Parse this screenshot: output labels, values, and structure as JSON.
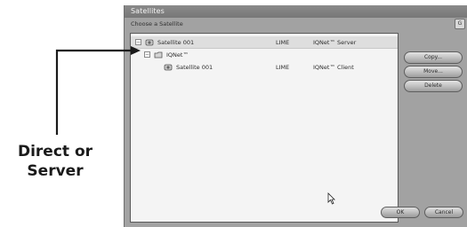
{
  "dialog": {
    "title": "Satellites",
    "caption": "Choose a Satellite",
    "corner_label": "G"
  },
  "list": {
    "rows": [
      {
        "name": "Satellite 001",
        "type": "LIME",
        "role": "IQNet™ Server",
        "icon": "satellite-icon"
      },
      {
        "name": "IQNet™",
        "type": "",
        "role": "",
        "icon": "folder-icon"
      },
      {
        "name": "Satellite 001",
        "type": "LIME",
        "role": "IQNet™ Client",
        "icon": "satellite-icon"
      }
    ]
  },
  "side_buttons": {
    "copy": "Copy...",
    "move": "Move...",
    "delete": "Delete"
  },
  "bottom_buttons": {
    "ok": "OK",
    "cancel": "Cancel"
  },
  "annotation": {
    "line1": "Direct or",
    "line2": "Server"
  }
}
